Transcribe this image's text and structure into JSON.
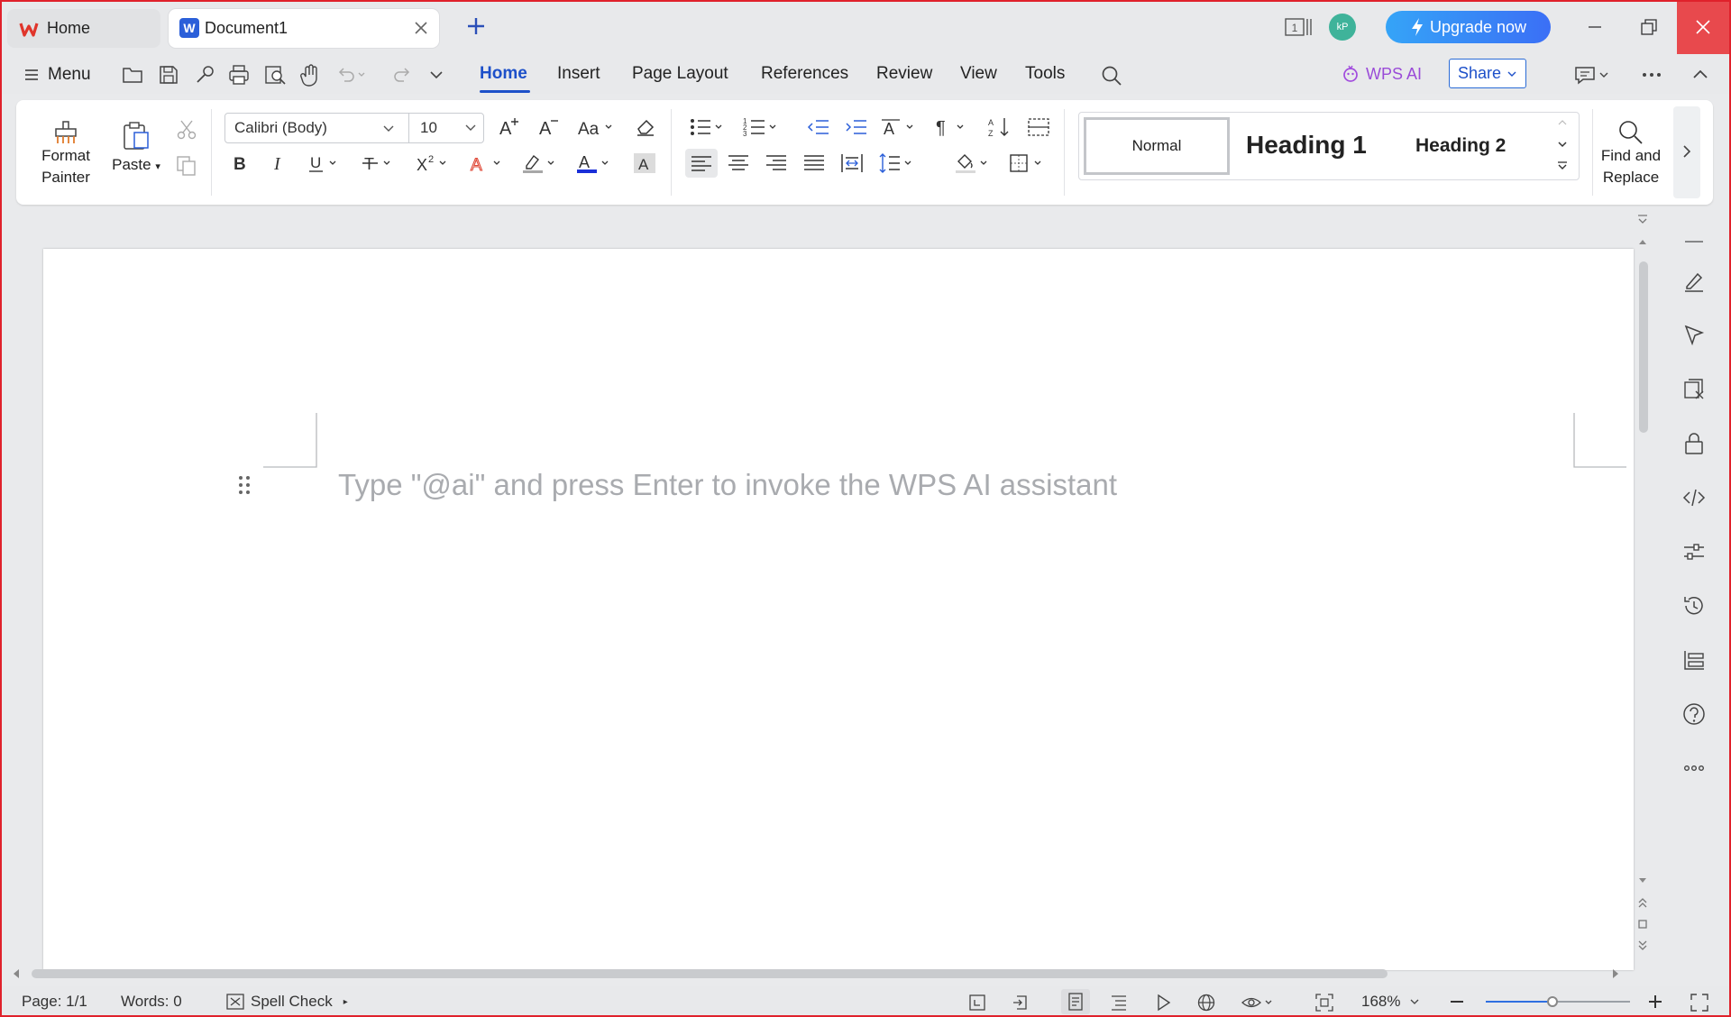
{
  "titlebar": {
    "tabs": [
      {
        "label": "Home",
        "icon": "wps-logo-icon"
      },
      {
        "label": "Document1",
        "icon": "word-doc-icon"
      }
    ],
    "new_tab_icon": "plus-icon",
    "layout_badge": "1",
    "avatar_initials": "kP",
    "upgrade_label": "Upgrade now",
    "accent_color": "#3b6ff6",
    "close_color": "#e8494d"
  },
  "menubar": {
    "menu_label": "Menu",
    "tabs": [
      "Home",
      "Insert",
      "Page Layout",
      "References",
      "Review",
      "View",
      "Tools"
    ],
    "active_tab": "Home",
    "wps_ai_label": "WPS AI",
    "share_label": "Share"
  },
  "ribbon": {
    "format_painter_label": "Format\nPainter",
    "paste_label": "Paste",
    "font_name": "Calibri (Body)",
    "font_size": "10",
    "styles": [
      "Normal",
      "Heading 1",
      "Heading 2"
    ],
    "find_replace_label": "Find and\nReplace"
  },
  "document": {
    "placeholder": "Type \"@ai\" and press Enter to invoke the WPS AI assistant"
  },
  "statusbar": {
    "page": "Page: 1/1",
    "words": "Words: 0",
    "spell_check": "Spell Check",
    "zoom": "168%",
    "zoom_fraction": 0.46
  }
}
